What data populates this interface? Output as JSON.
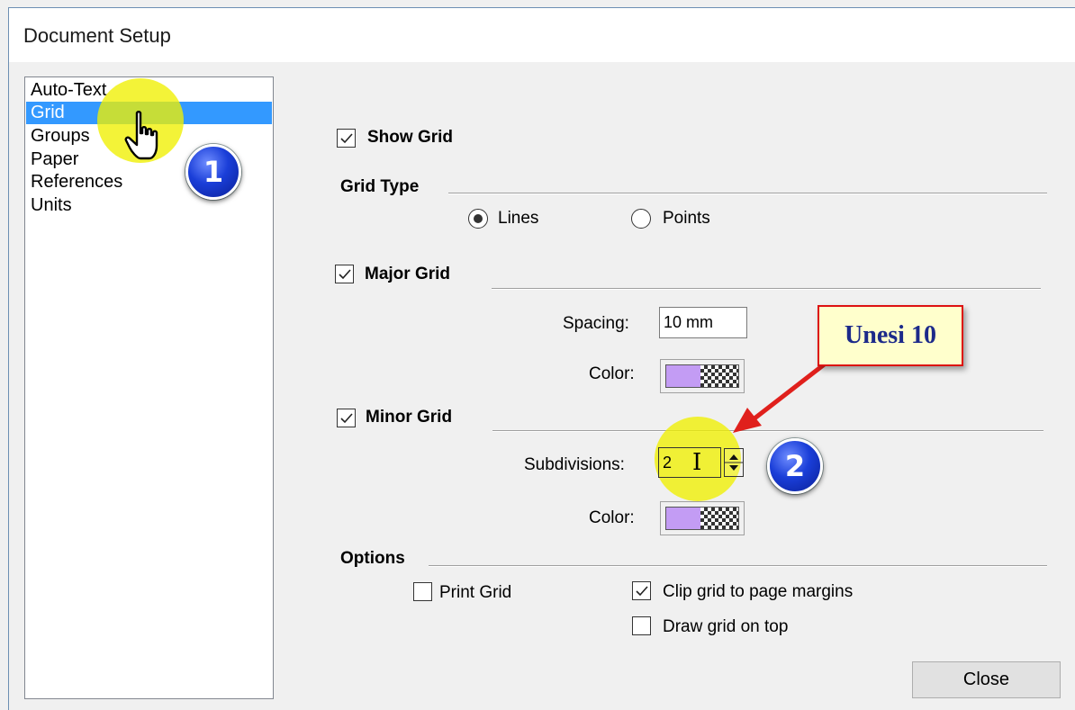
{
  "window": {
    "title": "Document Setup"
  },
  "sidebar": {
    "items": [
      {
        "label": "Auto-Text"
      },
      {
        "label": "Grid"
      },
      {
        "label": "Groups"
      },
      {
        "label": "Paper"
      },
      {
        "label": "References"
      },
      {
        "label": "Units"
      }
    ],
    "selected": "Grid"
  },
  "annotations": {
    "badge1": "1",
    "badge2": "2",
    "callout": "Unesi 10",
    "arrow_color": "#e0201c"
  },
  "grid": {
    "show_grid": {
      "label": "Show Grid",
      "checked": true
    },
    "grid_type": {
      "label": "Grid Type",
      "options": [
        "Lines",
        "Points"
      ],
      "selected": "Lines"
    },
    "major": {
      "label": "Major Grid",
      "checked": true,
      "spacing_label": "Spacing:",
      "spacing_value": "10 mm",
      "color_label": "Color:"
    },
    "minor": {
      "label": "Minor Grid",
      "checked": true,
      "subdiv_label": "Subdivisions:",
      "subdiv_value": "2",
      "color_label": "Color:"
    },
    "options": {
      "label": "Options",
      "print_grid": {
        "label": "Print Grid",
        "checked": false
      },
      "clip": {
        "label": "Clip grid to page margins",
        "checked": true
      },
      "on_top": {
        "label": "Draw grid on top",
        "checked": false
      }
    }
  },
  "colors": {
    "grid_swatch": "#c39cf4",
    "selection": "#3399ff"
  },
  "buttons": {
    "close": "Close"
  }
}
